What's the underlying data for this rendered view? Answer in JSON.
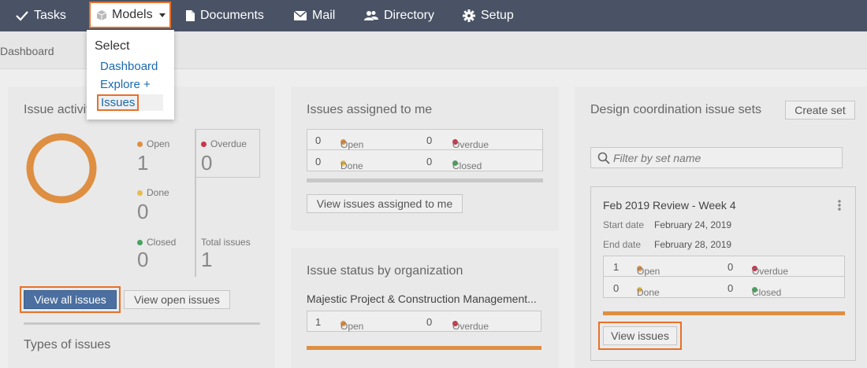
{
  "nav": {
    "tasks": "Tasks",
    "models": "Models",
    "documents": "Documents",
    "mail": "Mail",
    "directory": "Directory",
    "setup": "Setup"
  },
  "breadcrumb": "Dashboard",
  "dropdown": {
    "header": "Select",
    "items": [
      "Dashboard",
      "Explore +",
      "Issues"
    ]
  },
  "issue_activity": {
    "title": "Issue activity",
    "open_label": "Open",
    "open_value": "1",
    "overdue_label": "Overdue",
    "overdue_value": "0",
    "done_label": "Done",
    "done_value": "0",
    "closed_label": "Closed",
    "closed_value": "0",
    "total_label": "Total issues",
    "total_value": "1",
    "view_all_button": "View all issues",
    "view_open_button": "View open issues",
    "types_title": "Types of issues"
  },
  "assigned": {
    "title": "Issues assigned to me",
    "open_value": "0",
    "open_label": "Open",
    "overdue_value": "0",
    "overdue_label": "Overdue",
    "done_value": "0",
    "done_label": "Done",
    "closed_value": "0",
    "closed_label": "Closed",
    "view_button": "View issues assigned to me"
  },
  "by_org": {
    "title": "Issue status by organization",
    "org_name": "Majestic Project & Construction Management...",
    "open_value": "1",
    "open_label": "Open",
    "overdue_value": "0",
    "overdue_label": "Overdue"
  },
  "design_sets": {
    "title": "Design coordination issue sets",
    "create_button": "Create set",
    "filter_placeholder": "Filter by set name",
    "set": {
      "name": "Feb 2019 Review - Week 4",
      "start_label": "Start date",
      "start_value": "February 24, 2019",
      "end_label": "End date",
      "end_value": "February 28, 2019",
      "open_value": "1",
      "open_label": "Open",
      "overdue_value": "0",
      "overdue_label": "Overdue",
      "done_value": "0",
      "done_label": "Done",
      "closed_value": "0",
      "closed_label": "Closed",
      "view_button": "View issues"
    }
  },
  "colors": {
    "open": "#de8f42",
    "overdue": "#c9354a",
    "done": "#e8bb51",
    "closed": "#4aa25f",
    "primary_button": "#4a6fa0",
    "highlight": "#e8702a"
  },
  "icons": {
    "tasks": "check-icon",
    "models": "cube-icon",
    "documents": "document-icon",
    "mail": "envelope-icon",
    "directory": "people-icon",
    "setup": "gear-icon",
    "search": "search-icon",
    "menu": "kebab-icon"
  }
}
